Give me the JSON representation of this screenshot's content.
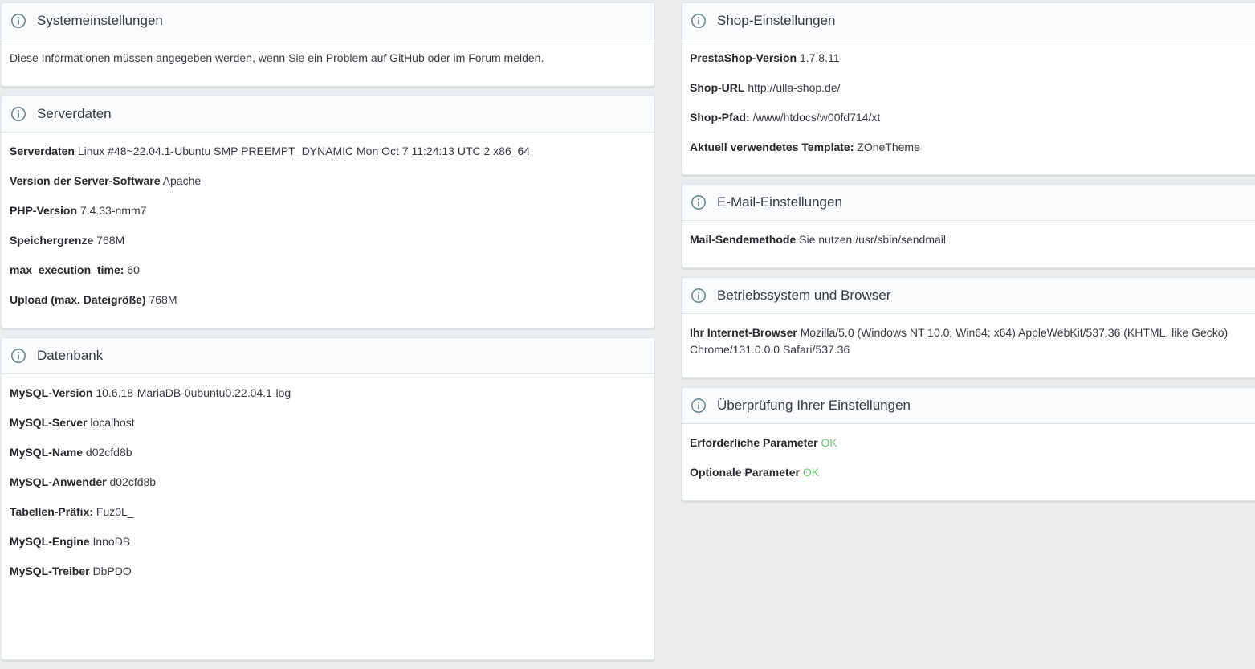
{
  "system": {
    "title": "Systemeinstellungen",
    "text": "Diese Informationen müssen angegeben werden, wenn Sie ein Problem auf GitHub oder im Forum melden."
  },
  "server": {
    "title": "Serverdaten",
    "rows": [
      {
        "label": "Serverdaten",
        "value": "Linux #48~22.04.1-Ubuntu SMP PREEMPT_DYNAMIC Mon Oct 7 11:24:13 UTC 2 x86_64"
      },
      {
        "label": "Version der Server-Software",
        "value": "Apache"
      },
      {
        "label": "PHP-Version",
        "value": "7.4.33-nmm7"
      },
      {
        "label": "Speichergrenze",
        "value": "768M"
      },
      {
        "label": "max_execution_time:",
        "value": "60"
      },
      {
        "label": "Upload (max. Dateigröße)",
        "value": "768M"
      }
    ]
  },
  "database": {
    "title": "Datenbank",
    "rows": [
      {
        "label": "MySQL-Version",
        "value": "10.6.18-MariaDB-0ubuntu0.22.04.1-log"
      },
      {
        "label": "MySQL-Server",
        "value": "localhost"
      },
      {
        "label": "MySQL-Name",
        "value": "d02cfd8b"
      },
      {
        "label": "MySQL-Anwender",
        "value": "d02cfd8b"
      },
      {
        "label": "Tabellen-Präfix:",
        "value": "Fuz0L_"
      },
      {
        "label": "MySQL-Engine",
        "value": "InnoDB"
      },
      {
        "label": "MySQL-Treiber",
        "value": "DbPDO"
      }
    ]
  },
  "shop": {
    "title": "Shop-Einstellungen",
    "rows": [
      {
        "label": "PrestaShop-Version",
        "value": "1.7.8.11"
      },
      {
        "label": "Shop-URL",
        "value": "http://ulla-shop.de/"
      },
      {
        "label": "Shop-Pfad:",
        "value": "/www/htdocs/w00fd714/xt"
      },
      {
        "label": "Aktuell verwendetes Template:",
        "value": "ZOneTheme"
      }
    ]
  },
  "mail": {
    "title": "E-Mail-Einstellungen",
    "rows": [
      {
        "label": "Mail-Sendemethode",
        "value": "Sie nutzen /usr/sbin/sendmail"
      }
    ]
  },
  "os": {
    "title": "Betriebssystem und Browser",
    "rows": [
      {
        "label": "Ihr Internet-Browser",
        "value": "Mozilla/5.0 (Windows NT 10.0; Win64; x64) AppleWebKit/537.36 (KHTML, like Gecko) Chrome/131.0.0.0 Safari/537.36"
      }
    ]
  },
  "check": {
    "title": "Überprüfung Ihrer Einstellungen",
    "rows": [
      {
        "label": "Erforderliche Parameter",
        "value": "OK"
      },
      {
        "label": "Optionale Parameter",
        "value": "OK"
      }
    ]
  },
  "colors": {
    "ok": "#72c279",
    "heading_bg": "#fafbfc",
    "page_bg": "#eaebec"
  },
  "icons": {
    "panel_icon": "info-circle-icon"
  }
}
